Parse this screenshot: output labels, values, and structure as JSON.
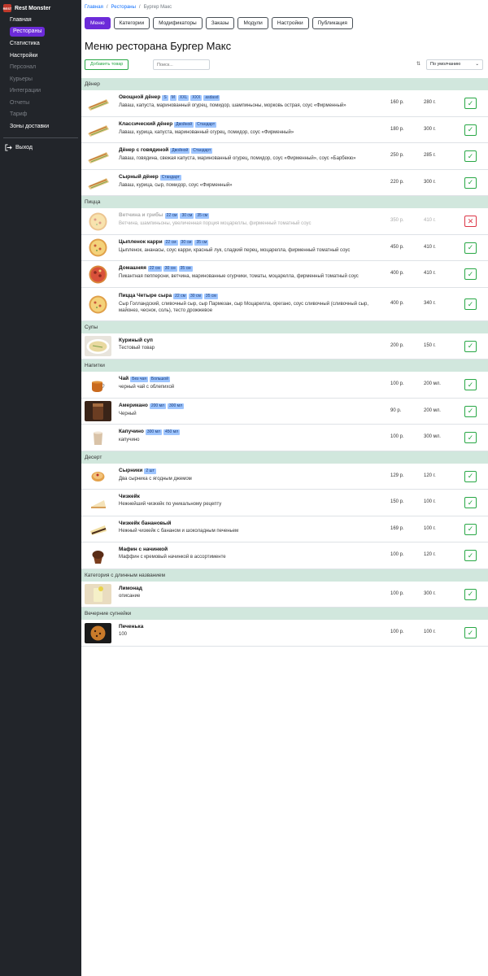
{
  "brand": {
    "name": "Rest Monster",
    "logo_text": "REST"
  },
  "sidebar": {
    "items": [
      {
        "label": "Главная",
        "state": "normal"
      },
      {
        "label": "Рестораны",
        "state": "active"
      },
      {
        "label": "Статистика",
        "state": "normal"
      },
      {
        "label": "Настройки",
        "state": "normal"
      },
      {
        "label": "Персонал",
        "state": "muted"
      },
      {
        "label": "Курьеры",
        "state": "muted"
      },
      {
        "label": "Интеграции",
        "state": "muted"
      },
      {
        "label": "Отчеты",
        "state": "muted"
      },
      {
        "label": "Тариф",
        "state": "muted"
      },
      {
        "label": "Зоны доставки",
        "state": "normal"
      }
    ],
    "logout": "Выход"
  },
  "breadcrumb": {
    "home": "Главная",
    "restaurants": "Рестораны",
    "current": "Бургер Макс"
  },
  "tabs": [
    "Меню",
    "Категории",
    "Модификаторы",
    "Заказы",
    "Модули",
    "Настройки",
    "Публикация"
  ],
  "page_title": "Меню ресторана Бургер Макс",
  "toolbar": {
    "add_label": "Добавить товар",
    "search_placeholder": "Поиск...",
    "sort_value": "По умолчанию"
  },
  "categories": [
    {
      "name": "Дёнер",
      "items": [
        {
          "name": "Овощной дёнер",
          "tags": [
            "S",
            "M",
            "XXL",
            "XXX",
            "asdasd"
          ],
          "desc": "Лаваш, капуста, маринованный огурец, помидор, шампиньоны, морковь острая, соус «Фирменный»",
          "price": "160 р.",
          "weight": "280 г.",
          "enabled": true,
          "image": "wrap"
        },
        {
          "name": "Классический дёнер",
          "tags": [
            "Двойной",
            "Стандарт"
          ],
          "desc": "Лаваш, курица, капуста, маринованный огурец, помидор, соус «Фирменный»",
          "price": "180 р.",
          "weight": "300 г.",
          "enabled": true,
          "image": "wrap"
        },
        {
          "name": "Дёнер с говядиной",
          "tags": [
            "Двойной",
            "Стандарт"
          ],
          "desc": "Лаваш, говядина, свежая капуста, маринованный огурец, помидор, соус «Фирменный», соус «Барбекю»",
          "price": "250 р.",
          "weight": "285 г.",
          "enabled": true,
          "image": "wrap"
        },
        {
          "name": "Сырный дёнер",
          "tags": [
            "Стандарт"
          ],
          "desc": "Лаваш, курица, сыр, помидор, соус «Фирменный»",
          "price": "220 р.",
          "weight": "300 г.",
          "enabled": true,
          "image": "wrap"
        }
      ]
    },
    {
      "name": "Пицца",
      "items": [
        {
          "name": "Ветчина и грибы",
          "tags": [
            "22 см",
            "30 см",
            "35 см"
          ],
          "desc": "Ветчина, шампиньоны, увеличенная порция моцареллы, фирменный томатный соус",
          "price": "350 р.",
          "weight": "410 г.",
          "enabled": false,
          "image": "pizza"
        },
        {
          "name": "Цыпленок карри",
          "tags": [
            "22 см",
            "30 см",
            "35 см"
          ],
          "desc": "Цыпленок, ананасы, соус карри, красный лук, сладкий перец, моцарелла, фирменный томатный соус",
          "price": "450 р.",
          "weight": "410 г.",
          "enabled": true,
          "image": "pizza"
        },
        {
          "name": "Домашняя",
          "tags": [
            "22 см",
            "30 см",
            "35 см"
          ],
          "desc": "Пикантная пепперони, ветчина, маринованные огурчики, томаты, моцарелла, фирменный томатный соус",
          "price": "400 р.",
          "weight": "410 г.",
          "enabled": true,
          "image": "pizza-red"
        },
        {
          "name": "Пицца Четыре сыра",
          "tags": [
            "22 см",
            "30 см",
            "35 см"
          ],
          "desc": "Сыр Голландский, сливочный сыр, сыр Пармезан, сыр Моцарелла, орегано, соус сливочный (сливочный сыр, майонез, чеснок, соль), тесто дрожжевое",
          "price": "400 р.",
          "weight": "340 г.",
          "enabled": true,
          "image": "pizza"
        }
      ]
    },
    {
      "name": "Супы",
      "items": [
        {
          "name": "Куриный суп",
          "tags": [],
          "desc": "Тестовый товар",
          "price": "200 р.",
          "weight": "150 г.",
          "enabled": true,
          "image": "soup"
        }
      ]
    },
    {
      "name": "Напитки",
      "items": [
        {
          "name": "Чай",
          "tags": [
            "Без чая",
            "Большой"
          ],
          "desc": "черный чай с облепихой",
          "price": "100 р.",
          "weight": "200 мл.",
          "enabled": true,
          "image": "tea"
        },
        {
          "name": "Американо",
          "tags": [
            "200 мл",
            "300 мл"
          ],
          "desc": "Черный",
          "price": "90 р.",
          "weight": "200 мл.",
          "enabled": true,
          "image": "coffee-dark"
        },
        {
          "name": "Капучино",
          "tags": [
            "300 мл",
            "450 мл"
          ],
          "desc": "капучино",
          "price": "100 р.",
          "weight": "300 мл.",
          "enabled": true,
          "image": "cappuccino"
        }
      ]
    },
    {
      "name": "Десерт",
      "items": [
        {
          "name": "Сырники",
          "tags": [
            "2 шт"
          ],
          "desc": "Два сырника с ягодным джемом",
          "price": "129 р.",
          "weight": "120 г.",
          "enabled": true,
          "image": "pancake"
        },
        {
          "name": "Чизкейк",
          "tags": [],
          "desc": "Нежнейший чизкейк по уникальному рецепту",
          "price": "150 р.",
          "weight": "100 г.",
          "enabled": true,
          "image": "cheesecake"
        },
        {
          "name": "Чизкейк банановый",
          "tags": [],
          "desc": "Нежный чизкейк с бананом и шоколадным печеньем",
          "price": "169 р.",
          "weight": "100 г.",
          "enabled": true,
          "image": "banana"
        },
        {
          "name": "Мафин с начинкой",
          "tags": [],
          "desc": "Маффин с кремовый начинкой в ассортименте",
          "price": "100 р.",
          "weight": "120 г.",
          "enabled": true,
          "image": "muffin"
        }
      ]
    },
    {
      "name": "Категория с длинным названием",
      "items": [
        {
          "name": "Лимонад",
          "tags": [],
          "desc": "описание",
          "price": "100 р.",
          "weight": "300 г.",
          "enabled": true,
          "image": "lemonade"
        }
      ]
    },
    {
      "name": "Вечерние сугнейки",
      "items": [
        {
          "name": "Печенька",
          "tags": [],
          "desc": "100",
          "price": "100 р.",
          "weight": "100 г.",
          "enabled": true,
          "image": "cookie"
        }
      ]
    }
  ]
}
